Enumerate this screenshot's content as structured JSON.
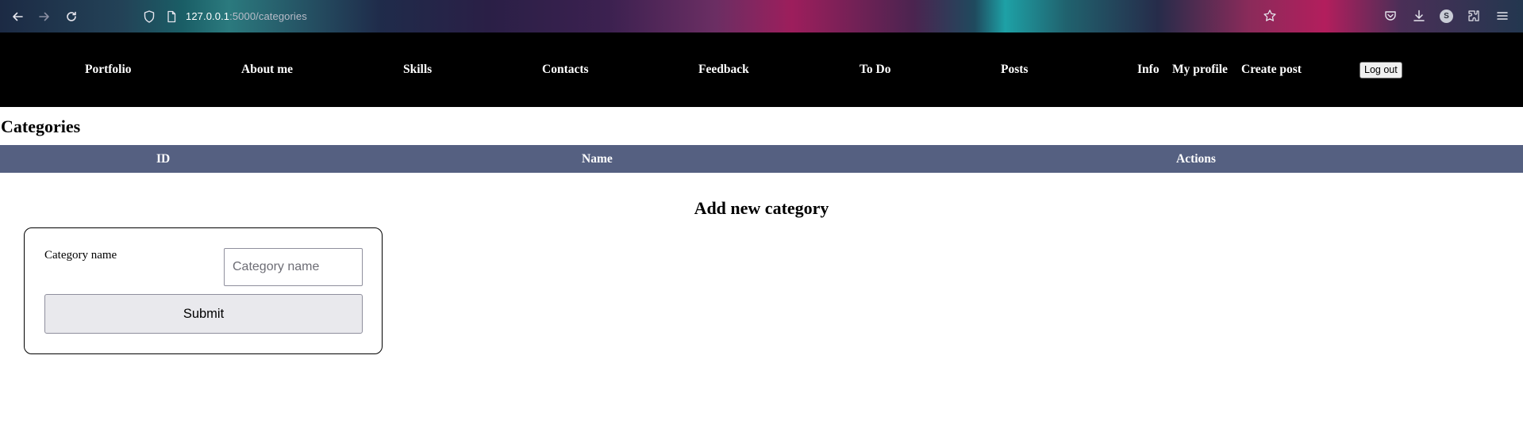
{
  "browser": {
    "url_host": "127.0.0.1",
    "url_path": ":5000/categories",
    "icons": [
      "back-icon",
      "forward-icon",
      "reload-icon",
      "shield-icon",
      "page-icon",
      "star-icon",
      "pocket-icon",
      "download-icon",
      "profile-icon",
      "extensions-icon",
      "menu-icon"
    ],
    "profile_initial": "S"
  },
  "nav": {
    "links": [
      "Portfolio",
      "About me",
      "Skills",
      "Contacts",
      "Feedback",
      "To Do",
      "Posts",
      "Info",
      "My profile",
      "Create post"
    ],
    "logout_label": "Log out"
  },
  "page": {
    "title": "Categories",
    "table_headers": [
      "ID",
      "Name",
      "Actions"
    ],
    "header_color": "#556081"
  },
  "form": {
    "title": "Add new category",
    "label": "Category name",
    "placeholder": "Category name",
    "value": "",
    "submit_label": "Submit"
  }
}
